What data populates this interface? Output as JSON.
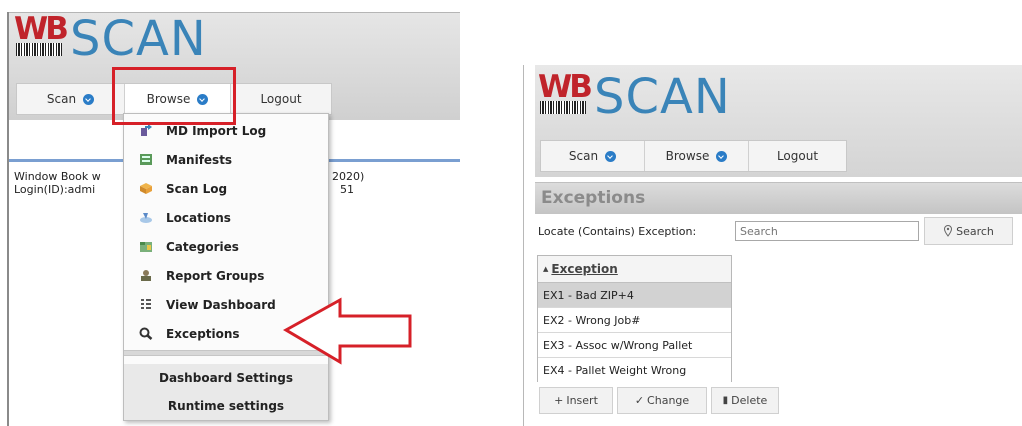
{
  "left": {
    "logo": {
      "mark": "WB",
      "name": "SCAN"
    },
    "nav": [
      {
        "label": "Scan"
      },
      {
        "label": "Browse"
      },
      {
        "label": "Logout"
      }
    ],
    "info_lines": [
      "Window Book w",
      "Login(ID):admi"
    ],
    "info_tail": [
      "2020)",
      "51"
    ],
    "menu": {
      "items": [
        {
          "label": "MD Import Log",
          "icon": "import-log-icon"
        },
        {
          "label": "Manifests",
          "icon": "manifest-icon"
        },
        {
          "label": "Scan Log",
          "icon": "box-icon"
        },
        {
          "label": "Locations",
          "icon": "location-icon"
        },
        {
          "label": "Categories",
          "icon": "folder-icon"
        },
        {
          "label": "Report Groups",
          "icon": "report-group-icon"
        },
        {
          "label": "View Dashboard",
          "icon": "dashboard-icon"
        },
        {
          "label": "Exceptions",
          "icon": "magnifier-icon"
        }
      ],
      "bottom_items": [
        {
          "label": "Dashboard Settings"
        },
        {
          "label": "Runtime settings"
        }
      ]
    },
    "highlight_color": "#d62028"
  },
  "right": {
    "logo": {
      "mark": "WB",
      "name": "SCAN"
    },
    "nav": [
      {
        "label": "Scan"
      },
      {
        "label": "Browse"
      },
      {
        "label": "Logout"
      }
    ],
    "page_title": "Exceptions",
    "locate_label": "Locate (Contains) Exception:",
    "search_placeholder": "Search",
    "search_button": "Search",
    "table": {
      "header": "Exception",
      "rows": [
        "EX1 - Bad ZIP+4",
        "EX2 - Wrong Job#",
        "EX3 - Assoc w/Wrong Pallet",
        "EX4 - Pallet Weight Wrong"
      ]
    },
    "actions": {
      "insert": "Insert",
      "change": "Change",
      "delete": "Delete"
    }
  }
}
